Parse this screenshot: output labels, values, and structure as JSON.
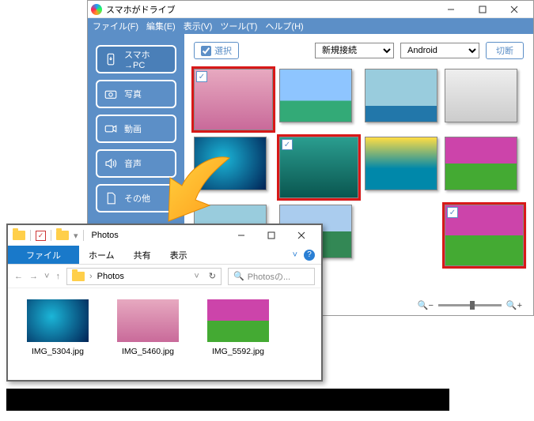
{
  "app": {
    "title": "スマホがドライブ",
    "menu": {
      "file": "ファイル(F)",
      "edit": "編集(E)",
      "view": "表示(V)",
      "tool": "ツール(T)",
      "help": "ヘルプ(H)"
    },
    "nav": {
      "transfer": "スマホ→PC",
      "photo": "写真",
      "video": "動画",
      "audio": "音声",
      "other": "その他"
    },
    "toolbar": {
      "select": "選択",
      "conn": "新規接続",
      "platform": "Android",
      "disconnect": "切断"
    }
  },
  "explorer": {
    "title": "Photos",
    "ribbon": {
      "file": "ファイル",
      "home": "ホーム",
      "share": "共有",
      "view": "表示"
    },
    "path": "Photos",
    "search_placeholder": "Photosの...",
    "files": [
      "IMG_5304.jpg",
      "IMG_5460.jpg",
      "IMG_5592.jpg"
    ]
  }
}
